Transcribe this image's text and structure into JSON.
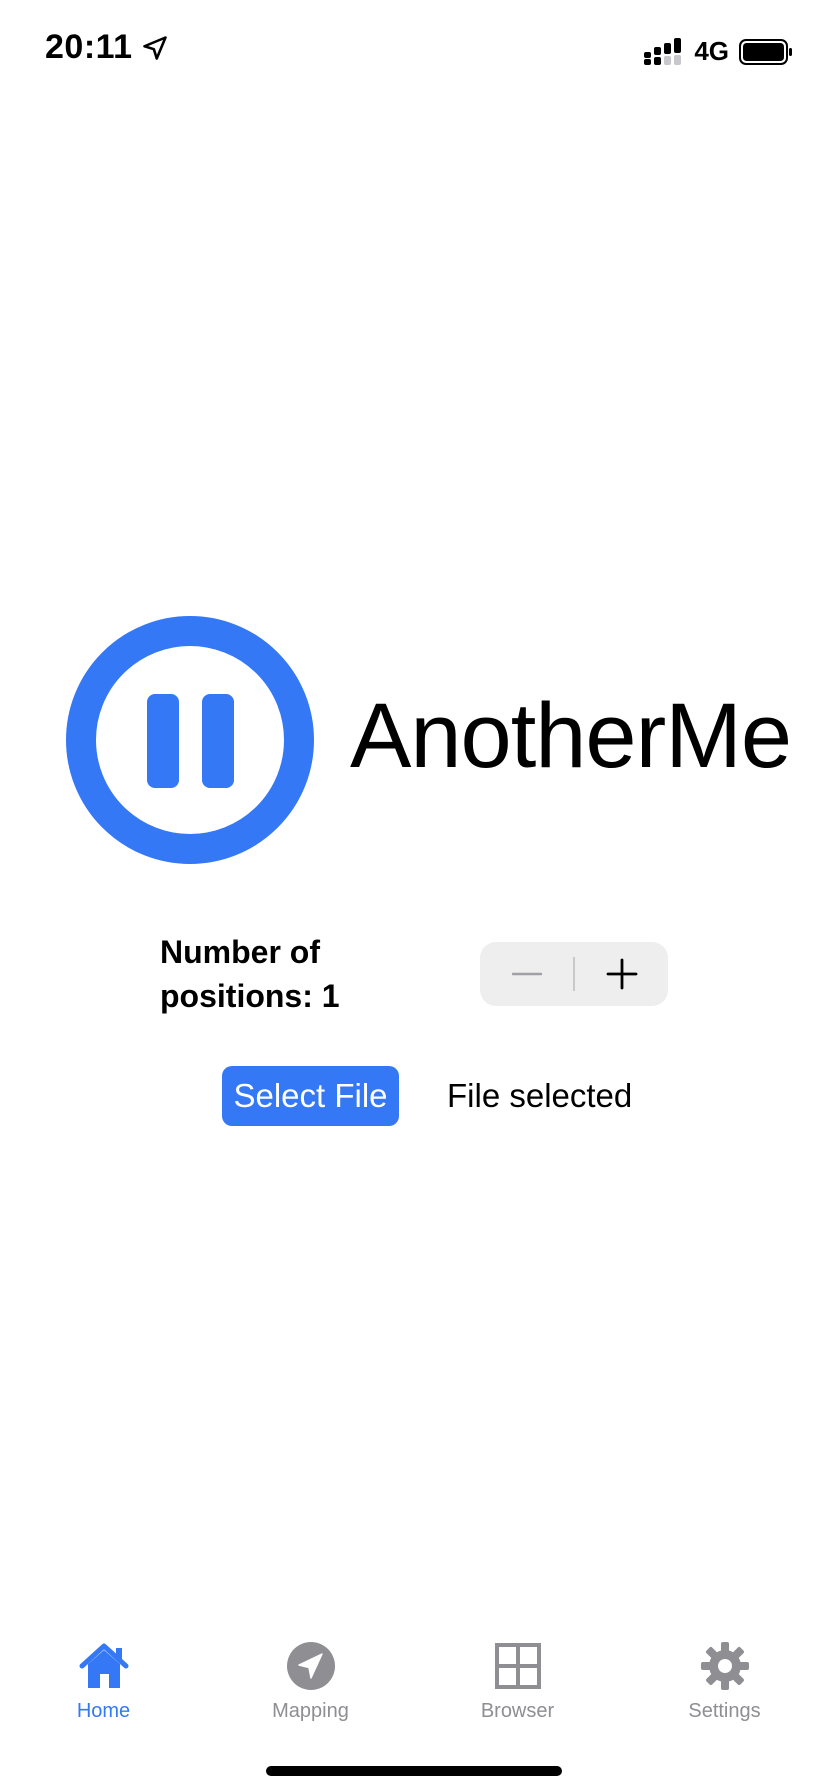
{
  "status_bar": {
    "time": "20:11",
    "network": "4G",
    "icons": [
      "location-arrow-icon",
      "signal-icon",
      "battery-icon"
    ]
  },
  "colors": {
    "accent": "#3478f6",
    "tab_inactive": "#8e8e93",
    "stepper_bg": "#eeeeef"
  },
  "app": {
    "name": "AnotherMe",
    "logo_icon": "pause-circle-icon"
  },
  "positions": {
    "label_line1": "Number of",
    "label_line2": "positions: 1",
    "decrement_icon": "minus-icon",
    "increment_icon": "plus-icon"
  },
  "file": {
    "button_label": "Select File",
    "status": "File selected"
  },
  "tabs": [
    {
      "label": "Home",
      "icon": "home-icon",
      "active": true
    },
    {
      "label": "Mapping",
      "icon": "navigation-arrow-icon",
      "active": false
    },
    {
      "label": "Browser",
      "icon": "grid-icon",
      "active": false
    },
    {
      "label": "Settings",
      "icon": "gear-icon",
      "active": false
    }
  ]
}
